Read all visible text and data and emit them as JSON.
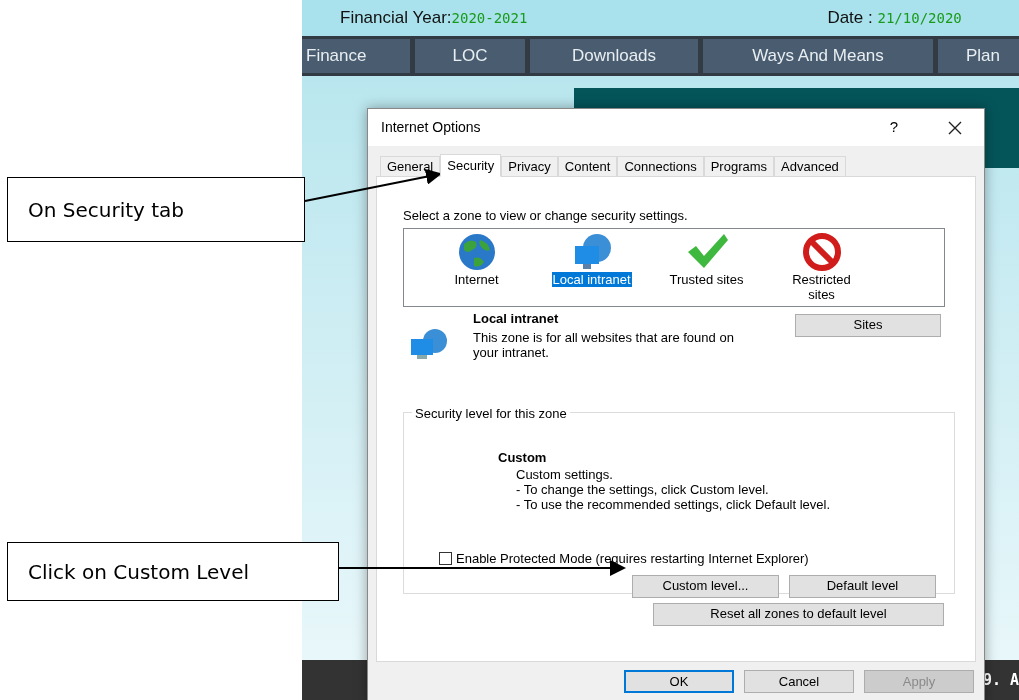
{
  "site": {
    "financial_year_label": "Financial Year:",
    "financial_year": "2020-2021",
    "date_label": "Date : ",
    "date": "21/10/2020",
    "nav": [
      "Finance",
      "LOC",
      "Downloads",
      "Ways And Means",
      "Plan"
    ],
    "footer_text": "9. A"
  },
  "callouts": [
    {
      "text": "On Security tab"
    },
    {
      "text": "Click on Custom Level"
    }
  ],
  "dialog": {
    "title": "Internet Options",
    "help": "?",
    "tabs": [
      {
        "label": "General",
        "selected": false
      },
      {
        "label": "Security",
        "selected": true
      },
      {
        "label": "Privacy",
        "selected": false
      },
      {
        "label": "Content",
        "selected": false
      },
      {
        "label": "Connections",
        "selected": false
      },
      {
        "label": "Programs",
        "selected": false
      },
      {
        "label": "Advanced",
        "selected": false
      }
    ],
    "prompt": "Select a zone to view or change security settings.",
    "zones": [
      {
        "label": "Internet",
        "selected": false
      },
      {
        "label": "Local intranet",
        "selected": true
      },
      {
        "label": "Trusted sites",
        "selected": false
      },
      {
        "label": "Restricted sites",
        "selected": false
      }
    ],
    "zone_info": {
      "name": "Local intranet",
      "description": "This zone is for all websites that are found on your intranet."
    },
    "sites_button": "Sites",
    "level_group": {
      "legend": "Security level for this zone",
      "level_name": "Custom",
      "lines": [
        "Custom settings.",
        "- To change the settings, click Custom level.",
        "- To use the recommended settings, click Default level."
      ],
      "protected_mode": {
        "label": "Enable Protected Mode (requires restarting Internet Explorer)",
        "checked": false
      },
      "custom_level_button": "Custom level...",
      "default_level_button": "Default level"
    },
    "reset_button": "Reset all zones to default level",
    "footer_buttons": [
      {
        "label": "OK",
        "focused": true,
        "disabled": false
      },
      {
        "label": "Cancel",
        "focused": false,
        "disabled": false
      },
      {
        "label": "Apply",
        "focused": false,
        "disabled": true
      }
    ]
  }
}
